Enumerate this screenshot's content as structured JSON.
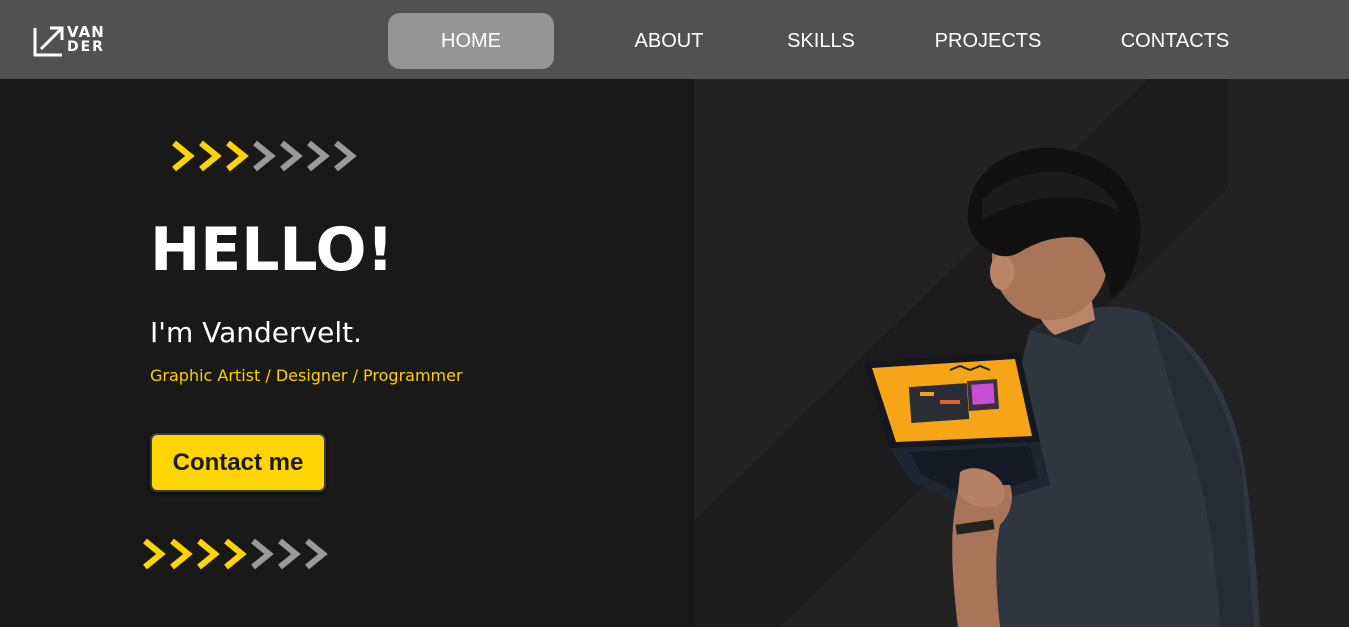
{
  "brand": {
    "logo_line1": "VAN",
    "logo_line2": "DER"
  },
  "nav": {
    "items": [
      {
        "label": "HOME",
        "active": true
      },
      {
        "label": "ABOUT",
        "active": false
      },
      {
        "label": "SKILLS",
        "active": false
      },
      {
        "label": "PROJECTS",
        "active": false
      },
      {
        "label": "CONTACTS",
        "active": false
      }
    ]
  },
  "hero": {
    "title": "HELLO!",
    "name": "I'm Vandervelt.",
    "roles": "Graphic Artist / Designer / Programmer",
    "cta_label": "Contact me",
    "top_arrows": {
      "yellow": 3,
      "gray": 4
    },
    "bottom_arrows": {
      "yellow": 4,
      "gray": 3
    }
  },
  "colors": {
    "navbar": "#515151",
    "nav_active": "#959595",
    "background": "#191919",
    "accent": "#ffd500",
    "arrow_gray": "#9a9a9a",
    "panel": "#242424"
  },
  "icons": {
    "logo": "arrow-up-right-corner-icon",
    "chevron": "chevron-right-icon"
  }
}
